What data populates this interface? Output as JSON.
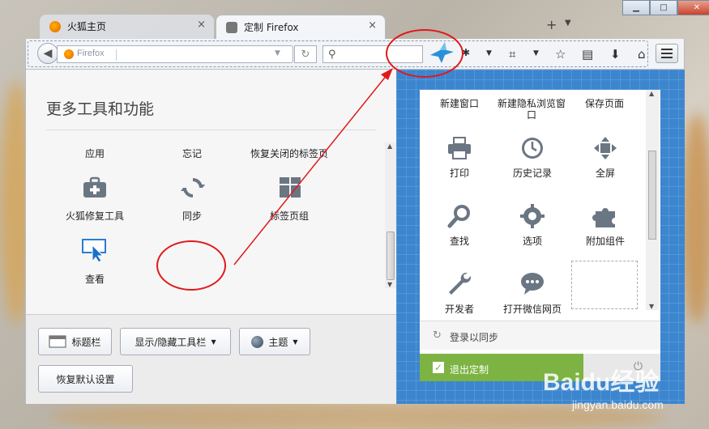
{
  "tabs": [
    {
      "label": "火狐主页"
    },
    {
      "label": "定制 Firefox"
    }
  ],
  "toolbar": {
    "url_label": "Firefox",
    "addon_label": "xThunder"
  },
  "more_tools": {
    "title": "更多工具和功能",
    "items": [
      {
        "label": "应用"
      },
      {
        "label": "忘记"
      },
      {
        "label": "恢复关闭的标签页"
      },
      {
        "label": "火狐修复工具"
      },
      {
        "label": "同步"
      },
      {
        "label": "标签页组"
      },
      {
        "label": "查看"
      }
    ]
  },
  "bottom_buttons": {
    "titlebar": "标题栏",
    "toolbars": "显示/隐藏工具栏",
    "themes": "主题",
    "restore": "恢复默认设置"
  },
  "menu_panel": {
    "items": [
      {
        "label": "新建窗口"
      },
      {
        "label": "新建隐私浏览窗口"
      },
      {
        "label": "保存页面"
      },
      {
        "label": "打印"
      },
      {
        "label": "历史记录"
      },
      {
        "label": "全屏"
      },
      {
        "label": "查找"
      },
      {
        "label": "选项"
      },
      {
        "label": "附加组件"
      },
      {
        "label": "开发者"
      },
      {
        "label": "打开微信网页"
      }
    ],
    "sync_label": "登录以同步",
    "exit_label": "退出定制"
  },
  "watermark": {
    "brand": "Baidu经验",
    "url": "jingyan.baidu.com"
  },
  "colors": {
    "panel_blue": "#3c86cf",
    "exit_green": "#7cb342",
    "annotation_red": "#e0191b"
  }
}
